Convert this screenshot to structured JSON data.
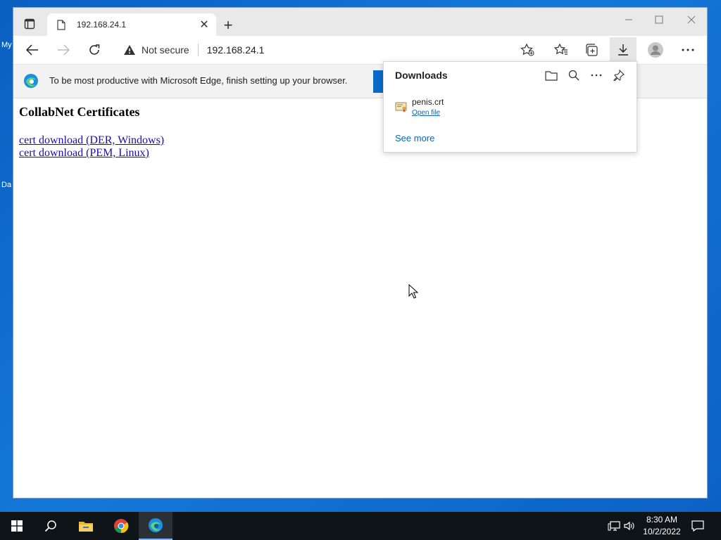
{
  "desktop": {
    "labels": [
      "My",
      "Da"
    ]
  },
  "browser": {
    "tab": {
      "title": "192.168.24.1"
    },
    "new_tab_symbol": "+",
    "window_controls": [
      "minimize-icon",
      "maximize-icon",
      "close-icon"
    ],
    "address": {
      "security_label": "Not secure",
      "url": "192.168.24.1"
    },
    "toolbar_icons": [
      "back-icon",
      "forward-icon",
      "refresh-icon",
      "add-favorite-icon",
      "favorites-icon",
      "collections-icon",
      "downloads-icon",
      "profile-icon",
      "more-icon"
    ]
  },
  "infobar": {
    "message": "To be most productive with Microsoft Edge, finish setting up your browser."
  },
  "page": {
    "heading": "CollabNet Certificates",
    "links": [
      "cert download (DER, Windows)",
      "cert download (PEM, Linux)"
    ]
  },
  "downloads": {
    "title": "Downloads",
    "item": {
      "filename": "penis.crt",
      "action": "Open file"
    },
    "see_more": "See more"
  },
  "taskbar": {
    "time": "8:30 AM",
    "date": "10/2/2022"
  },
  "colors": {
    "link": "#1a0dab",
    "accent": "#0a64b8",
    "taskbar": "#0f1419",
    "desktop": "#0a64c8"
  }
}
